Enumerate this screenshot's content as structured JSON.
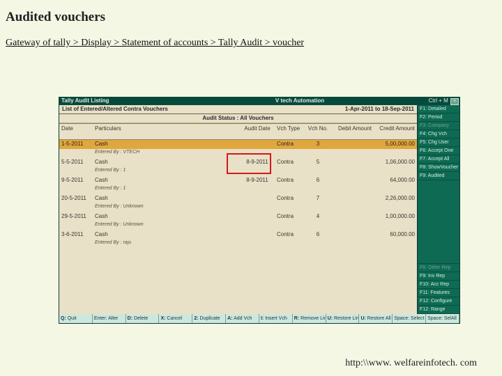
{
  "page": {
    "title": "Audited  vouchers",
    "breadcrumb": "Gateway of tally > Display > Statement of accounts > Tally Audit > voucher",
    "footer": "http:\\\\www. welfareinfotech. com"
  },
  "titlebar": {
    "left": "Tally Audit Listing",
    "center": "V tech Automation",
    "right": "Ctrl + M"
  },
  "subbar": {
    "left": "List of Entered/Altered Contra Vouchers",
    "right": "1-Apr-2011 to 18-Sep-2011"
  },
  "statusbar": "Audit Status : All Vouchers",
  "columns": {
    "date": "Date",
    "particulars": "Particulars",
    "auditdate": "Audit Date",
    "vchtype": "Vch Type",
    "vchno": "Vch No.",
    "debit": "Debit\nAmount",
    "credit": "Credit\nAmount"
  },
  "rows": [
    {
      "sel": true,
      "date": "1-5-2011",
      "part": "Cash",
      "auditdate": "",
      "vch": "Contra",
      "no": "3",
      "debit": "",
      "credit": "5,00,000.00",
      "by": "VTECH"
    },
    {
      "sel": false,
      "date": "5-5-2011",
      "part": "Cash",
      "auditdate": "8-9-2011",
      "vch": "Contra",
      "no": "5",
      "debit": "",
      "credit": "1,06,000.00",
      "by": "1"
    },
    {
      "sel": false,
      "date": "9-5-2011",
      "part": "Cash",
      "auditdate": "8-9-2011",
      "vch": "Contra",
      "no": "6",
      "debit": "",
      "credit": "64,000.00",
      "by": "1"
    },
    {
      "sel": false,
      "date": "20-5-2011",
      "part": "Cash",
      "auditdate": "",
      "vch": "Contra",
      "no": "7",
      "debit": "",
      "credit": "2,26,000.00",
      "by": "Unknown"
    },
    {
      "sel": false,
      "date": "29-5-2011",
      "part": "Cash",
      "auditdate": "",
      "vch": "Contra",
      "no": "4",
      "debit": "",
      "credit": "1,00,000.00",
      "by": "Unknown"
    },
    {
      "sel": false,
      "date": "3-6-2011",
      "part": "Cash",
      "auditdate": "",
      "vch": "Contra",
      "no": "6",
      "debit": "",
      "credit": "60,000.00",
      "by": "raju"
    }
  ],
  "entered_by_label": "Entered By :",
  "sidebar_top": [
    {
      "k": "F1:",
      "t": "Detailed"
    },
    {
      "k": "F2:",
      "t": "Period"
    },
    {
      "k": "F3:",
      "t": "Company",
      "dis": true
    },
    {
      "k": "F4:",
      "t": "Chg Vch"
    },
    {
      "k": "F5:",
      "t": "Chg User"
    },
    {
      "k": "F6:",
      "t": "Accept One"
    },
    {
      "k": "F7:",
      "t": "Accept All"
    },
    {
      "k": "F8:",
      "t": "ShowVoucher"
    },
    {
      "k": "F9:",
      "t": "Audited"
    }
  ],
  "sidebar_bottom": [
    {
      "k": "F8:",
      "t": "Other Rep",
      "dis": true
    },
    {
      "k": "F9:",
      "t": "Inv Rep"
    },
    {
      "k": "F10:",
      "t": "Acc Rep"
    },
    {
      "k": "F11:",
      "t": "Features"
    },
    {
      "k": "F12:",
      "t": "Configure"
    },
    {
      "k": "F12:",
      "t": "Range"
    }
  ],
  "bottom": [
    {
      "k": "Q:",
      "t": "Quit"
    },
    {
      "k": "",
      "t": "Enter: Alter"
    },
    {
      "k": "D:",
      "t": "Delete"
    },
    {
      "k": "X:",
      "t": "Cancel"
    },
    {
      "k": "2:",
      "t": "Duplicate"
    },
    {
      "k": "A:",
      "t": "Add Vch"
    },
    {
      "k": "I:",
      "t": "Insert Vch"
    },
    {
      "k": "R:",
      "t": "Remove Line"
    },
    {
      "k": "U:",
      "t": "Restore Line"
    },
    {
      "k": "U:",
      "t": "Restore All"
    },
    {
      "k": "",
      "t": "Space: Select"
    },
    {
      "k": "",
      "t": "Space: SelAll"
    }
  ]
}
